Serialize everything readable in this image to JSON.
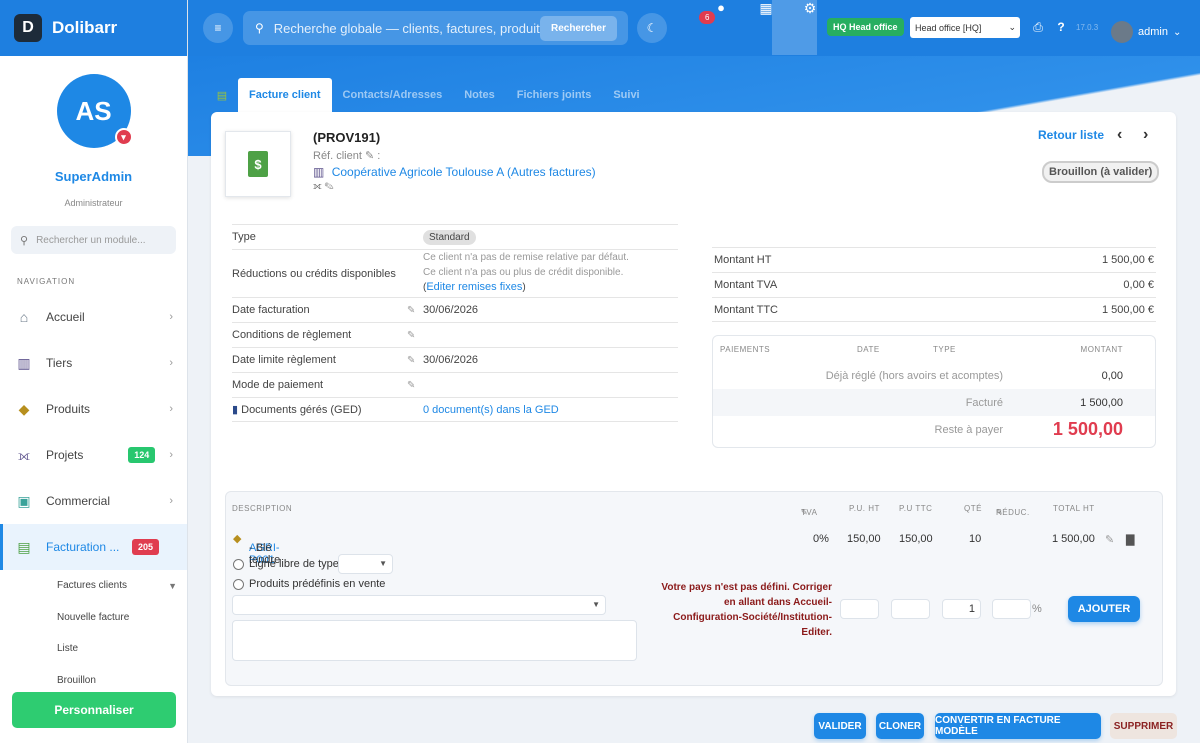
{
  "app": {
    "name": "Dolibarr",
    "logo_letter": "D"
  },
  "user": {
    "initials": "AS",
    "name": "SuperAdmin",
    "role": "Administrateur",
    "header_name": "admin"
  },
  "sidebar": {
    "search_placeholder": "Rechercher un module...",
    "nav_heading": "NAVIGATION",
    "items": [
      {
        "label": "Accueil",
        "icon": "home-icon"
      },
      {
        "label": "Tiers",
        "icon": "building-icon"
      },
      {
        "label": "Produits",
        "icon": "box-icon"
      },
      {
        "label": "Projets",
        "icon": "project-icon",
        "count": "124"
      },
      {
        "label": "Commercial",
        "icon": "briefcase-icon"
      },
      {
        "label": "Facturation ...",
        "icon": "invoice-icon",
        "count": "205"
      }
    ],
    "subitems": [
      "Factures clients",
      "Nouvelle facture",
      "Liste",
      "Brouillon"
    ],
    "personalize": "Personnaliser"
  },
  "topbar": {
    "search_placeholder": "Recherche globale — clients, factures, produits...",
    "search_button": "Rechercher",
    "notif_count": "6",
    "entity_badge": "HQ Head office",
    "entity_select": "Head office [HQ]",
    "version": "17.0.3"
  },
  "tabs": [
    "Facture client",
    "Contacts/Adresses",
    "Notes",
    "Fichiers joints",
    "Suivi"
  ],
  "invoice": {
    "ref": "(PROV191)",
    "ref_client_label": "Réf. client",
    "client": "Coopérative Agricole Toulouse A",
    "client_suffix": "(Autres factures)",
    "back_link": "Retour liste",
    "status": "Brouillon (à valider)"
  },
  "fields": {
    "type_label": "Type",
    "type_value": "Standard",
    "reduc_label": "Réductions ou crédits disponibles",
    "reduc_line1": "Ce client n'a pas de remise relative par défaut.",
    "reduc_line2": "Ce client n'a pas ou plus de crédit disponible.",
    "reduc_link": "Editer remises fixes",
    "date_label": "Date facturation",
    "date_value": "30/06/2026",
    "cond_label": "Conditions de règlement",
    "limit_label": "Date limite règlement",
    "limit_value": "30/06/2026",
    "mode_label": "Mode de paiement",
    "ged_label": "Documents gérés (GED)",
    "ged_value": "0 document(s) dans la GED"
  },
  "totals": [
    {
      "label": "Montant HT",
      "value": "1 500,00 €"
    },
    {
      "label": "Montant TVA",
      "value": "0,00 €"
    },
    {
      "label": "Montant TTC",
      "value": "1 500,00 €"
    }
  ],
  "payments": {
    "headers": [
      "PAIEMENTS",
      "DATE",
      "TYPE",
      "MONTANT"
    ],
    "already_label": "Déjà réglé (hors avoirs et acomptes)",
    "already_value": "0,00",
    "billed_label": "Facturé",
    "billed_value": "1 500,00",
    "remain_label": "Reste à payer",
    "remain_value": "1 500,00"
  },
  "lines": {
    "headers": {
      "desc": "DESCRIPTION",
      "tva": "TVA",
      "puht": "P.U. HT",
      "puttc": "P.U TTC",
      "qty": "QTÉ",
      "reduc": "RÉDUC.",
      "total": "TOTAL HT"
    },
    "row": {
      "code": "AGRI-P001",
      "label": "- Blé tendre",
      "tva": "0%",
      "puht": "150,00",
      "puttc": "150,00",
      "qty": "10",
      "total": "1 500,00"
    },
    "free_line": "Ligne libre de type",
    "predef": "Produits prédéfinis en vente",
    "qty_default": "1",
    "percent": "%",
    "warning": "Votre pays n'est pas défini. Corriger en allant dans Accueil-Configuration-Société/Institution-Editer.",
    "add_button": "AJOUTER"
  },
  "actions": [
    "VALIDER",
    "CLONER",
    "CONVERTIR EN FACTURE MODÈLE",
    "SUPPRIMER"
  ]
}
